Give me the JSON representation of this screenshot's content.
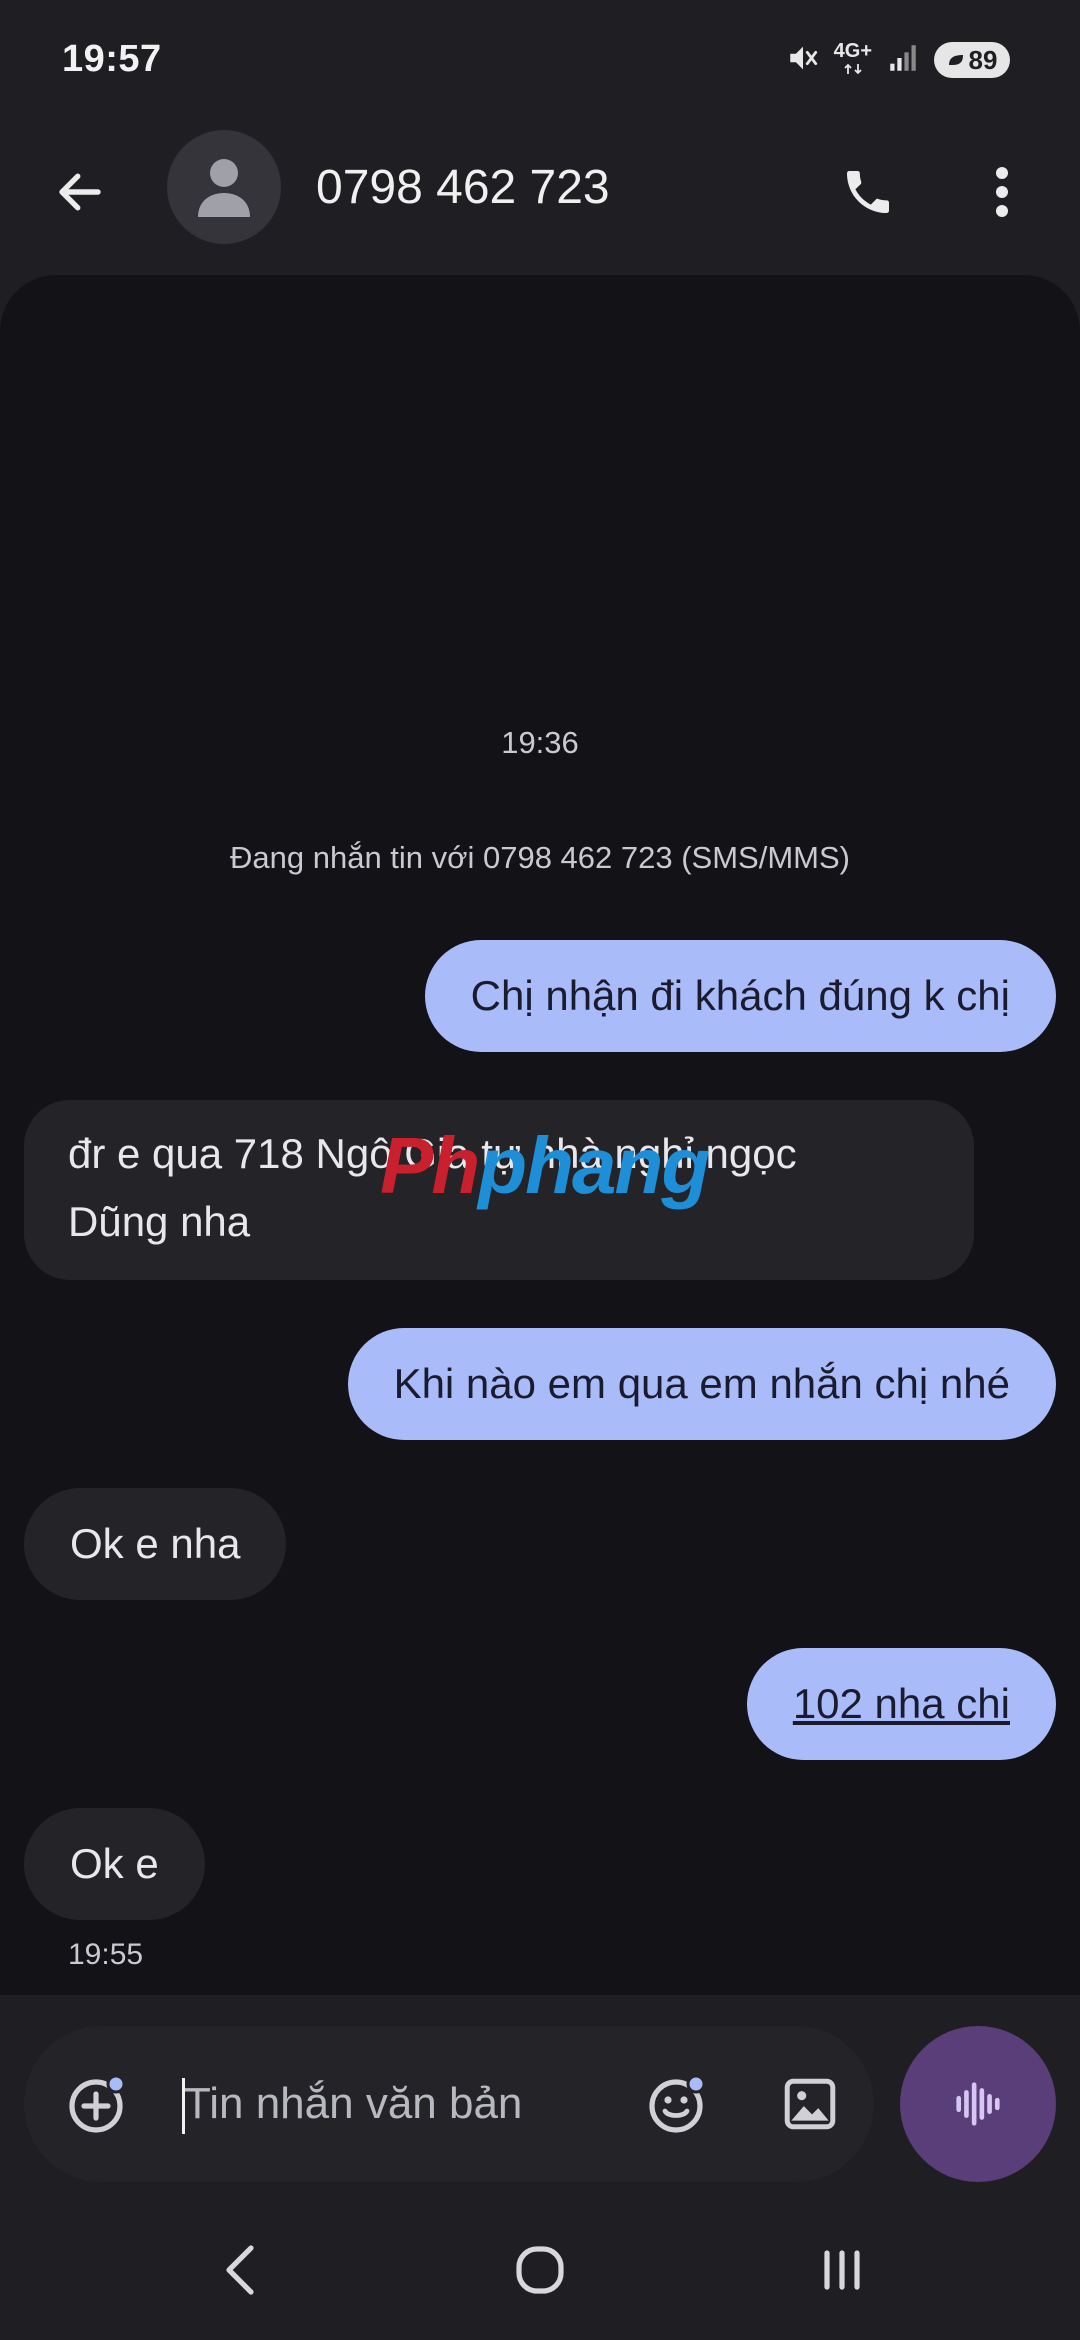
{
  "status_bar": {
    "time": "19:57",
    "network": "4G+",
    "battery": "89",
    "icons": [
      "mute-icon",
      "network-4g-icon",
      "signal-icon",
      "battery-icon"
    ]
  },
  "header": {
    "contact": "0798 462 723",
    "icons": [
      "back-arrow-icon",
      "person-icon",
      "phone-icon",
      "more-vert-icon"
    ]
  },
  "conversation": {
    "timestamp_top": "19:36",
    "info": "Đang nhắn tin với 0798 462 723 (SMS/MMS)",
    "messages": [
      {
        "direction": "outgoing",
        "text": "Chị nhận đi khách đúng k chị"
      },
      {
        "direction": "incoming",
        "line1": "đr e qua 718 Ngô Gia tự nhà nghỉ ngọc",
        "line2": "Dũng nha"
      },
      {
        "direction": "outgoing",
        "text": "Khi nào em qua em nhắn chị nhé"
      },
      {
        "direction": "incoming",
        "text": "Ok e nha"
      },
      {
        "direction": "outgoing",
        "text": "102 nha chi"
      },
      {
        "direction": "incoming",
        "text": "Ok e"
      }
    ],
    "timestamp_last": "19:55",
    "watermark": {
      "part1": "Ph",
      "part2": "phang"
    }
  },
  "composer": {
    "placeholder": "Tin nhắn văn bản",
    "icons": [
      "add-icon",
      "emoji-icon",
      "image-icon",
      "voice-waveform-icon"
    ]
  },
  "navigation": {
    "icons": [
      "nav-back-icon",
      "nav-home-icon",
      "nav-recents-icon"
    ]
  },
  "colors": {
    "background": "#1f1f23",
    "panel": "#121217",
    "outgoing_bubble": "#a9bbf9",
    "incoming_bubble": "#232328",
    "voice_button": "#5a3e7a"
  }
}
